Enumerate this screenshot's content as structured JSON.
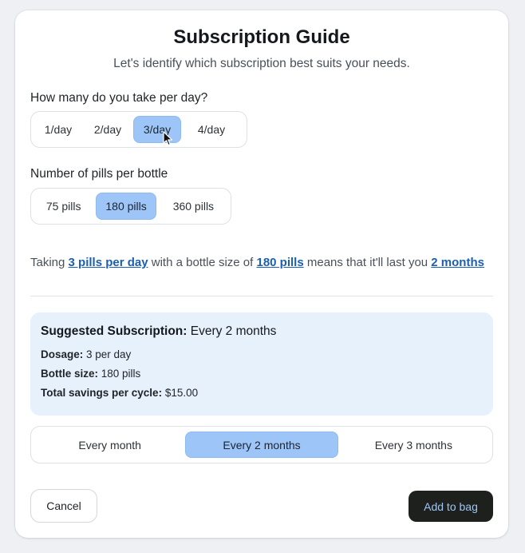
{
  "header": {
    "title": "Subscription Guide",
    "subtitle": "Let's identify which subscription best suits your needs."
  },
  "per_day": {
    "label": "How many do you take per day?",
    "options": [
      "1/day",
      "2/day",
      "3/day",
      "4/day"
    ],
    "selected": "3/day"
  },
  "bottle": {
    "label": "Number of pills per bottle",
    "options": [
      "75 pills",
      "180 pills",
      "360 pills"
    ],
    "selected": "180 pills"
  },
  "summary": {
    "prefix": "Taking ",
    "pills_per_day": "3 pills per day",
    "middle": " with a bottle size of ",
    "bottle_size": "180 pills",
    "middle2": " means that it'll last you ",
    "duration": "2 months"
  },
  "suggested": {
    "heading_label": "Suggested Subscription:",
    "heading_value": " Every 2 months",
    "dosage_label": "Dosage:",
    "dosage_value": " 3 per day",
    "bottle_label": "Bottle size:",
    "bottle_value": " 180 pills",
    "savings_label": "Total savings per cycle:",
    "savings_value": " $15.00"
  },
  "frequency": {
    "options": [
      "Every month",
      "Every 2 months",
      "Every 3 months"
    ],
    "selected": "Every 2 months"
  },
  "actions": {
    "cancel": "Cancel",
    "add": "Add to bag"
  },
  "colors": {
    "selected_bg": "#9ec5f7",
    "link": "#1a5fb4",
    "suggest_bg": "#e7f1fc",
    "primary_button_bg": "#1e201e"
  }
}
